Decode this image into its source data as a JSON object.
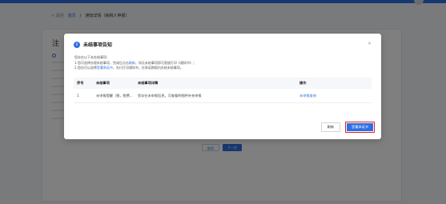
{
  "breadcrumb": {
    "back": "< 返回",
    "home": "首页",
    "sep": "/",
    "current": "通知详情（纳税人申报）"
  },
  "background": {
    "section_title": "注",
    "buttons": {
      "prev": "取消",
      "next": "下一步"
    }
  },
  "modal": {
    "title": "未结事项告知",
    "close": "×",
    "desc_intro": "您存在以下未办结事项:",
    "desc_line1_a": "1.您可选择办理未结事项，完成后点击",
    "desc_line1_link": "刷新",
    "desc_line1_b": "，如无未结事项即可直接打印《通知书》；",
    "desc_line2_a": "2.您也可以选择",
    "desc_line2_link": "签署承诺书",
    "desc_line2_b": "，先行打印通知书，在承诺期限内办结未结事项。",
    "table": {
      "headers": [
        "序号",
        "未结事项",
        "未结事项详情",
        "操作"
      ],
      "rows": [
        {
          "no": "1",
          "item": "未申报提醒（税，税费...",
          "detail": "您存在未申报信息，可查看明细并补充申报",
          "action": "未申报查询"
        }
      ]
    },
    "buttons": {
      "refresh": "刷新",
      "sign": "签署承诺书"
    }
  },
  "colors": {
    "accent": "#2f6fe0",
    "highlight_border": "#e02020"
  }
}
